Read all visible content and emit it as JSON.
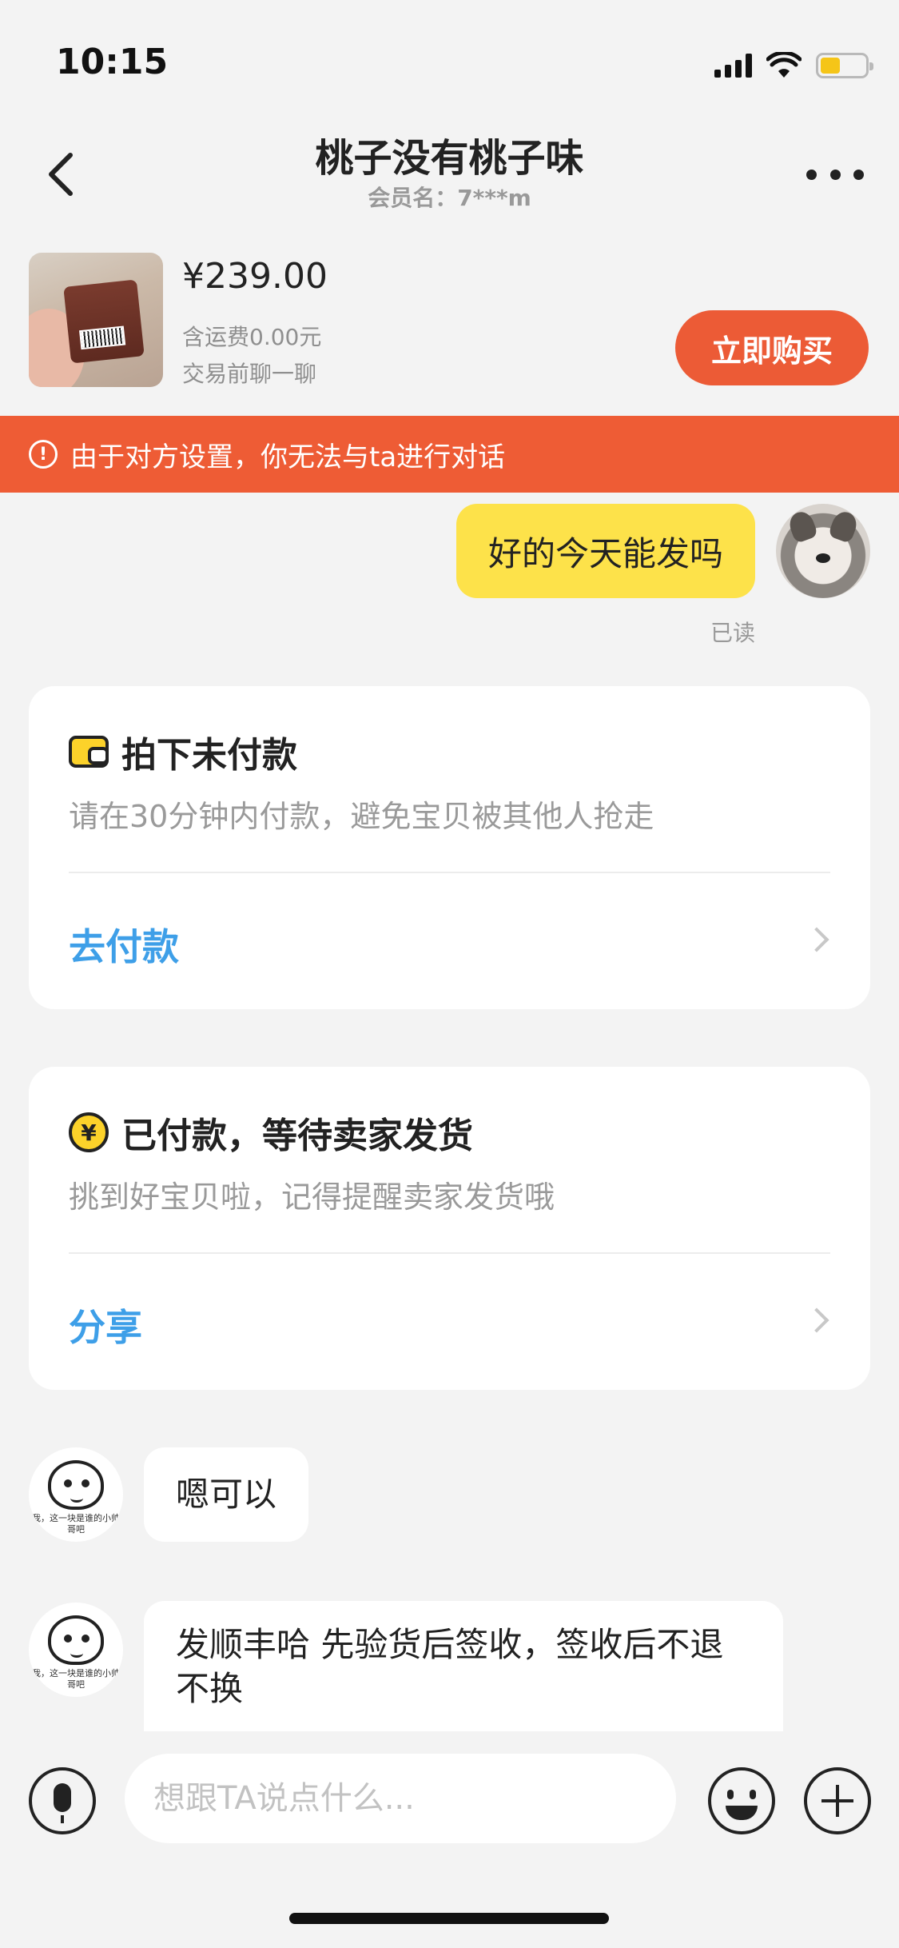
{
  "status_bar": {
    "time": "10:15"
  },
  "header": {
    "title": "桃子没有桃子味",
    "subtitle": "会员名：7***m"
  },
  "product": {
    "price": "¥239.00",
    "shipping": "含运费0.00元",
    "note": "交易前聊一聊",
    "buy_label": "立即购买"
  },
  "banner": {
    "icon": "!",
    "text": "由于对方设置，你无法与ta进行对话"
  },
  "messages": {
    "mine": {
      "text": "好的今天能发吗",
      "status": "已读"
    },
    "theirs": [
      {
        "text": "嗯可以"
      },
      {
        "text": "发顺丰哈 先验货后签收，签收后不退不换"
      }
    ]
  },
  "avatar_caption": "我，这一块是谁的小帅哥吧",
  "cards": [
    {
      "icon": "wallet-icon",
      "title": "拍下未付款",
      "desc": "请在30分钟内付款，避免宝贝被其他人抢走",
      "action": "去付款"
    },
    {
      "icon": "yen-icon",
      "icon_glyph": "¥",
      "title": "已付款，等待卖家发货",
      "desc": "挑到好宝贝啦，记得提醒卖家发货哦",
      "action": "分享"
    }
  ],
  "input": {
    "placeholder": "想跟TA说点什么..."
  },
  "colors": {
    "accent": "#ec5b36",
    "banner": "#ee5c35",
    "my_bubble": "#fde24a",
    "link": "#3e9fe8",
    "icon_yellow": "#fcd22a"
  }
}
